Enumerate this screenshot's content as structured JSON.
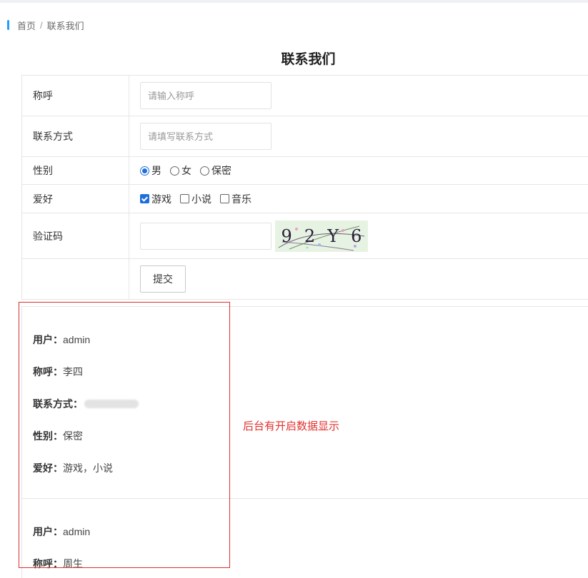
{
  "breadcrumb": {
    "home": "首页",
    "separator": "/",
    "current": "联系我们"
  },
  "page_title": "联系我们",
  "form": {
    "nickname": {
      "label": "称呼",
      "placeholder": "请输入称呼",
      "value": ""
    },
    "contact": {
      "label": "联系方式",
      "placeholder": "请填写联系方式",
      "value": ""
    },
    "gender": {
      "label": "性别",
      "options": [
        "男",
        "女",
        "保密"
      ],
      "selected": "男"
    },
    "hobby": {
      "label": "爱好",
      "options": [
        "游戏",
        "小说",
        "音乐"
      ],
      "checked": [
        "游戏"
      ]
    },
    "captcha": {
      "label": "验证码",
      "value": "",
      "image_text": [
        "9",
        "2",
        "Y",
        "6"
      ]
    },
    "submit_label": "提交"
  },
  "records": [
    {
      "user_label": "用户：",
      "user": "admin",
      "nickname_label": "称呼：",
      "nickname": "李四",
      "contact_label": "联系方式：",
      "gender_label": "性别：",
      "gender": "保密",
      "hobby_label": "爱好：",
      "hobby": "游戏，小说"
    },
    {
      "user_label": "用户：",
      "user": "admin",
      "nickname_label": "称呼：",
      "nickname": "周生"
    }
  ],
  "annotation": "后台有开启数据显示",
  "colors": {
    "accent": "#1e9fff",
    "checked": "#1e6fd9",
    "annotation": "#e0322f"
  }
}
